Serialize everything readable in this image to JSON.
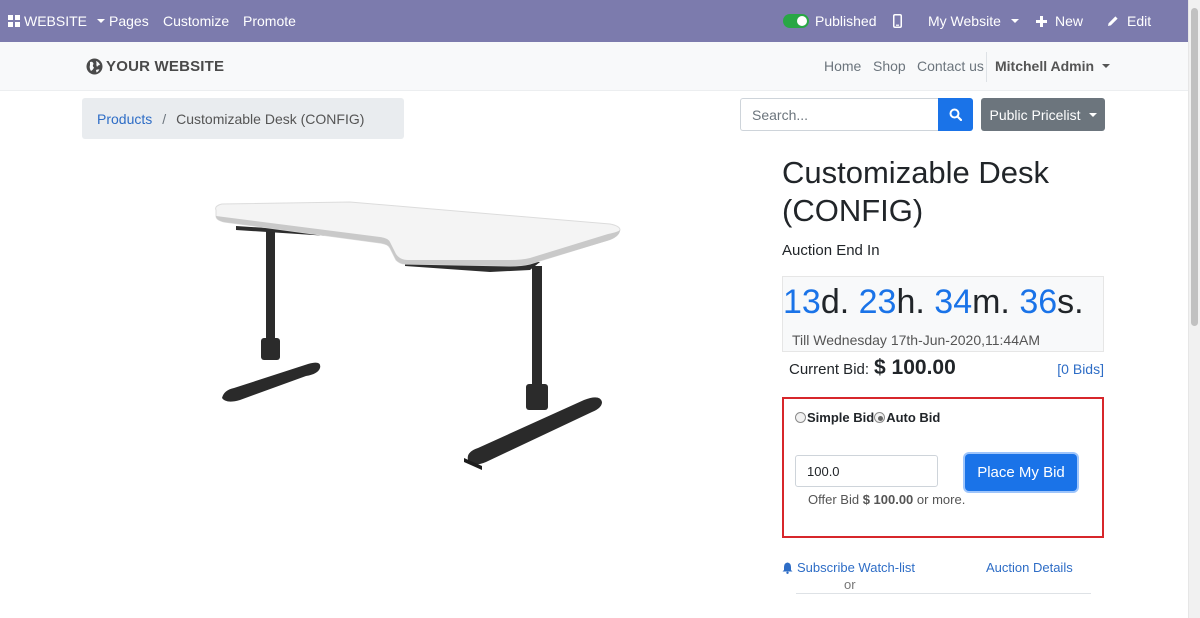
{
  "admin_bar": {
    "website_label": "WEBSITE",
    "pages_label": "Pages",
    "customize_label": "Customize",
    "promote_label": "Promote",
    "published_label": "Published",
    "my_website_label": "My Website",
    "new_label": "New",
    "edit_label": "Edit",
    "bg_color": "#7c7bad"
  },
  "site_header": {
    "logo_text": "YOUR WEBSITE",
    "nav": [
      "Home",
      "Shop",
      "Contact us"
    ],
    "user_label": "Mitchell Admin"
  },
  "breadcrumb": {
    "parent": "Products",
    "separator": "/",
    "current": "Customizable Desk (CONFIG)"
  },
  "search": {
    "placeholder": "Search..."
  },
  "pricelist": {
    "label": "Public Pricelist"
  },
  "product": {
    "title": "Customizable Desk (CONFIG)",
    "image_icon": "desk-image"
  },
  "auction": {
    "end_label": "Auction End In",
    "days": "13",
    "days_unit": "d. ",
    "hours": "23",
    "hours_unit": "h. ",
    "minutes": "34",
    "minutes_unit": "m. ",
    "seconds": "36",
    "seconds_unit": "s.",
    "till_text": "Till Wednesday 17th-Jun-2020,11:44AM",
    "current_bid_label": "Current Bid:",
    "current_bid_value": "$ 100.00",
    "bids_link": "[0 Bids]"
  },
  "bid_form": {
    "simple_bid_label": "Simple Bid",
    "auto_bid_label": "Auto Bid",
    "selected": "Auto Bid",
    "input_value": "100.0",
    "place_button": "Place My Bid",
    "offer_prefix": "Offer Bid",
    "offer_amount": "$ 100.00",
    "offer_suffix": "or more.",
    "highlight_color": "#d7262b"
  },
  "links": {
    "watchlist": "Subscribe Watch-list",
    "or": "or",
    "auction_details": "Auction Details"
  },
  "colors": {
    "primary": "#1a73e8",
    "link": "#2e6dc6"
  }
}
